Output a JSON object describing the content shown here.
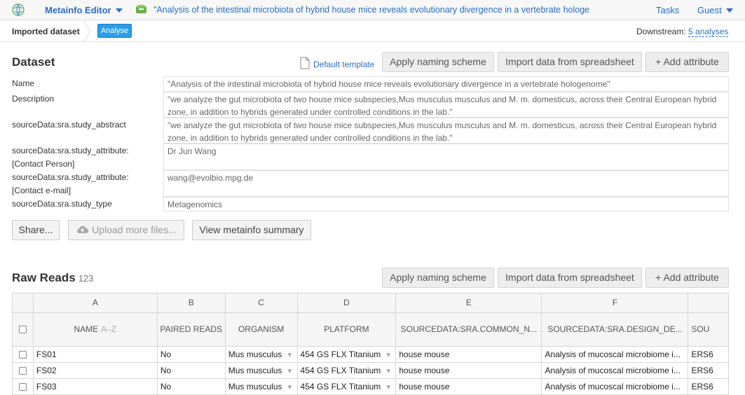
{
  "topbar": {
    "app_title": "Metainfo Editor",
    "doc_title": "\"Analysis of the intestinal microbiota of hybrid house mice reveals evolutionary divergence in a vertebrate hologe",
    "tasks": "Tasks",
    "user": "Guest"
  },
  "breadcrumb": {
    "imported": "Imported dataset",
    "analyse": "Analyse",
    "downstream_label": "Downstream:",
    "downstream_link": "5 analyses"
  },
  "dataset": {
    "title": "Dataset",
    "default_template": "Default template",
    "apply_naming": "Apply naming scheme",
    "import_spreadsheet": "Import data from spreadsheet",
    "add_attribute": "Add attribute",
    "fields": [
      {
        "label": "Name",
        "value": "\"Analysis of the intestinal microbiota of hybrid house mice reveals evolutionary divergence in a vertebrate hologenome\""
      },
      {
        "label": "Description",
        "value": "\"we analyze the gut microbiota of two house mice subspecies,Mus musculus musculus and M. m. domesticus, across their Central European hybrid zone, in addition to hybrids generated under controlled conditions in the lab.\""
      },
      {
        "label": "sourceData:sra.study_abstract",
        "value": "\"we analyze the gut microbiota of two house mice subspecies,Mus musculus musculus and M. m. domesticus, across their Central European hybrid zone, in addition to hybrids generated under controlled conditions in the lab.\""
      },
      {
        "label": "sourceData:sra.study_attribute: [Contact Person]",
        "value": "Dr Jun Wang"
      },
      {
        "label": "sourceData:sra.study_attribute: [Contact e-mail]",
        "value": "wang@evolbio.mpg.de"
      },
      {
        "label": "sourceData:sra.study_type",
        "value": "Metagenomics"
      }
    ],
    "share": "Share...",
    "upload": "Upload more files...",
    "view_summary": "View metainfo summary"
  },
  "raw_reads": {
    "title": "Raw Reads",
    "count": "123",
    "apply_naming": "Apply naming scheme",
    "import_spreadsheet": "Import data from spreadsheet",
    "add_attribute": "Add attribute",
    "column_letters": [
      "A",
      "B",
      "C",
      "D",
      "E",
      "F",
      ""
    ],
    "column_headers": [
      "NAME",
      "PAIRED READS",
      "ORGANISM",
      "PLATFORM",
      "SOURCEDATA:SRA.COMMON_N...",
      "SOURCEDATA:SRA.DESIGN_DE...",
      "SOU"
    ],
    "name_sort_hint": "A–Z",
    "rows": [
      {
        "name": "FS01",
        "paired": "No",
        "organism": "Mus musculus",
        "platform": "454 GS FLX Titanium",
        "common": "house mouse",
        "design": "Analysis of mucoscal microbiome i...",
        "sou": "ERS6"
      },
      {
        "name": "FS02",
        "paired": "No",
        "organism": "Mus musculus",
        "platform": "454 GS FLX Titanium",
        "common": "house mouse",
        "design": "Analysis of mucoscal microbiome i...",
        "sou": "ERS6"
      },
      {
        "name": "FS03",
        "paired": "No",
        "organism": "Mus musculus",
        "platform": "454 GS FLX Titanium",
        "common": "house mouse",
        "design": "Analysis of mucoscal microbiome i...",
        "sou": "ERS6"
      }
    ]
  },
  "icons": {
    "logo": "globe-logo-icon",
    "doc": "dataset-folder-icon",
    "template": "document-icon",
    "cloud": "cloud-upload-icon",
    "plus": "plus-icon"
  },
  "colors": {
    "link": "#2a6ebb",
    "accent_button": "#2c9ee6",
    "organism_green": "#5f9e2e"
  }
}
